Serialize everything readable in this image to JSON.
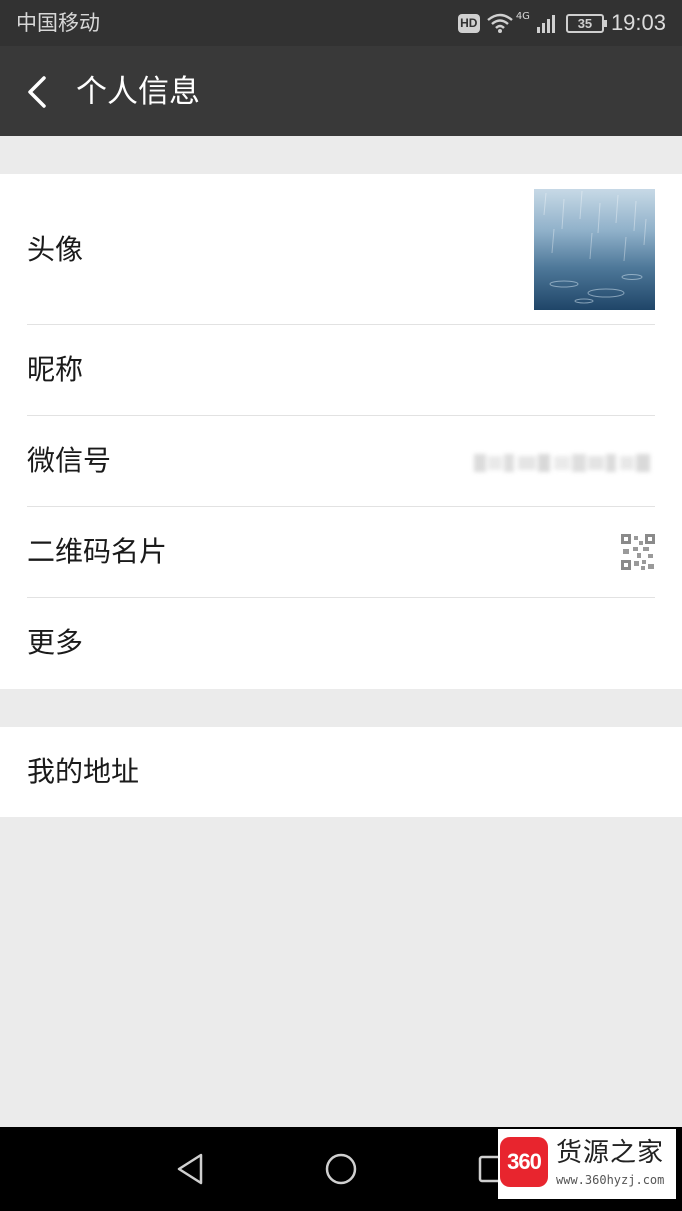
{
  "status_bar": {
    "carrier": "中国移动",
    "hd_badge": "HD",
    "network": "4G",
    "battery": "35",
    "time": "19:03"
  },
  "header": {
    "back_icon": "chevron-left-icon",
    "title": "个人信息"
  },
  "profile": {
    "avatar_label": "头像",
    "nickname_label": "昵称",
    "wechat_id_label": "微信号",
    "qr_card_label": "二维码名片",
    "qr_icon": "qr-code-icon",
    "more_label": "更多"
  },
  "address": {
    "label": "我的地址"
  },
  "nav_bar": {
    "back_icon": "triangle-back-icon",
    "home_icon": "circle-home-icon",
    "recent_icon": "square-recent-icon"
  },
  "watermark": {
    "badge": "360",
    "name": "货源之家",
    "url": "www.360hyzj.com"
  },
  "colors": {
    "status_bar_bg": "#323232",
    "title_bar_bg": "#393939",
    "page_bg": "#ebebeb",
    "row_bg": "#ffffff",
    "watermark_red": "#e8252e"
  }
}
